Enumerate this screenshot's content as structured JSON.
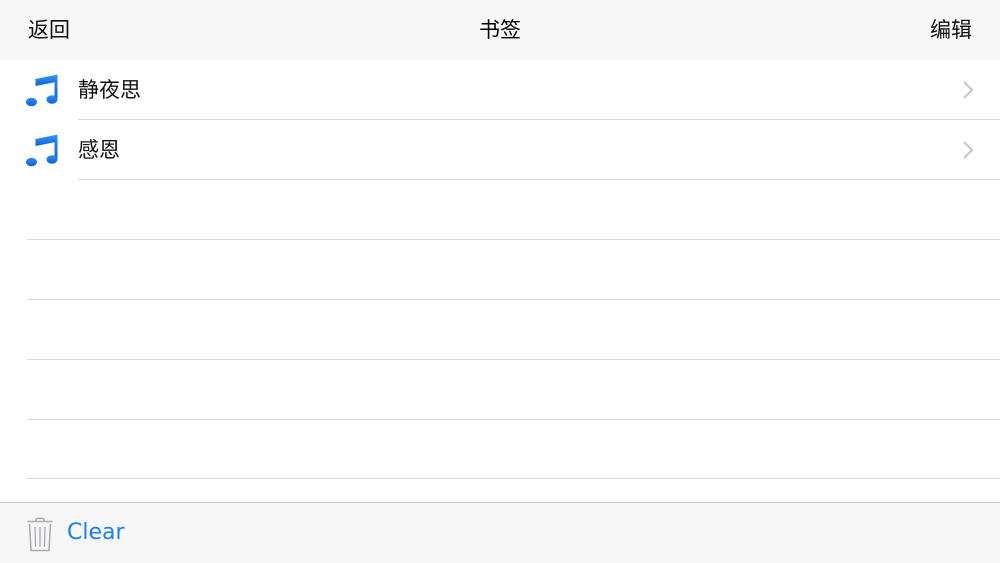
{
  "navbar": {
    "back_label": "返回",
    "title": "书签",
    "edit_label": "编辑"
  },
  "list": {
    "items": [
      {
        "label": "静夜思",
        "icon": "music-note-icon"
      },
      {
        "label": "感恩",
        "icon": "music-note-icon"
      }
    ]
  },
  "toolbar": {
    "trash_icon": "trash-icon",
    "clear_label": "Clear"
  },
  "colors": {
    "accent": "#1a7ef4",
    "bar_background": "#f7f7f7",
    "separator": "#d9d9dc"
  }
}
